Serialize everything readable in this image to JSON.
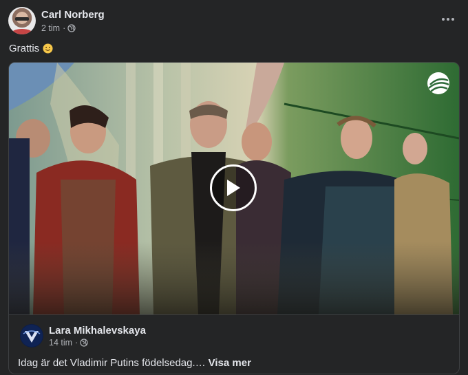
{
  "post": {
    "author": "Carl Norberg",
    "time": "2 tim",
    "separator": "·",
    "privacy_icon": "globe-icon",
    "text": "Grattis",
    "emoji": "slightly-smiling-face",
    "more_icon": "more-options-icon"
  },
  "shared_post": {
    "author": "Lara Mikhalevskaya",
    "time": "14 tim",
    "separator": "·",
    "privacy_icon": "globe-icon",
    "text": "Idag är det Vladimir Putins födelsedag.…",
    "see_more": "Visa mer",
    "video": {
      "play_icon": "play-icon",
      "channel_logo": "tv-channel-logo"
    }
  },
  "colors": {
    "background": "#242526",
    "text_primary": "#e4e6eb",
    "text_secondary": "#b0b3b8",
    "border": "#3e4042"
  }
}
